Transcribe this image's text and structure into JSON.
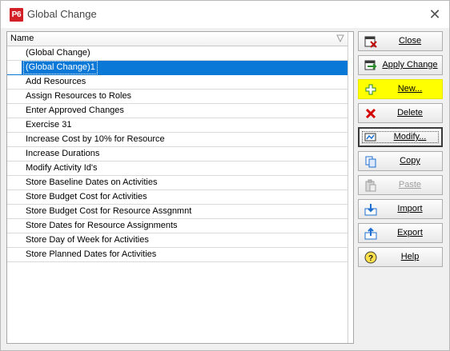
{
  "window": {
    "title": "Global Change",
    "app_icon_text": "P6",
    "close_glyph": "✕"
  },
  "list": {
    "column_header": "Name",
    "selected_index": 1,
    "items": [
      "(Global Change)",
      "(Global Change)1",
      "Add Resources",
      "Assign Resources to Roles",
      "Enter Approved Changes",
      "Exercise 31",
      "Increase Cost by 10% for Resource",
      "Increase Durations",
      "Modify Activity Id's",
      "Store Baseline Dates on Activities",
      "Store Budget Cost for Activities",
      "Store Budget Cost for Resource Assgnmnt",
      "Store Dates for Resource Assignments",
      "Store Day of Week for Activities",
      "Store Planned Dates for Activities"
    ]
  },
  "buttons": {
    "close": {
      "label": "Close",
      "icon": "close-doc-icon"
    },
    "apply_change": {
      "label": "Apply Change",
      "icon": "apply-change-icon"
    },
    "new": {
      "label": "New...",
      "icon": "plus-icon",
      "highlight_color": "#ffff00"
    },
    "delete": {
      "label": "Delete",
      "icon": "red-x-icon"
    },
    "modify": {
      "label": "Modify...",
      "icon": "modify-icon"
    },
    "copy": {
      "label": "Copy",
      "icon": "copy-icon"
    },
    "paste": {
      "label": "Paste",
      "icon": "paste-icon",
      "disabled": true
    },
    "import": {
      "label": "Import",
      "icon": "import-icon"
    },
    "export": {
      "label": "Export",
      "icon": "export-icon"
    },
    "help": {
      "label": "Help",
      "icon": "help-icon"
    }
  },
  "colors": {
    "selection": "#0a78d7",
    "app_icon": "#d32027"
  }
}
